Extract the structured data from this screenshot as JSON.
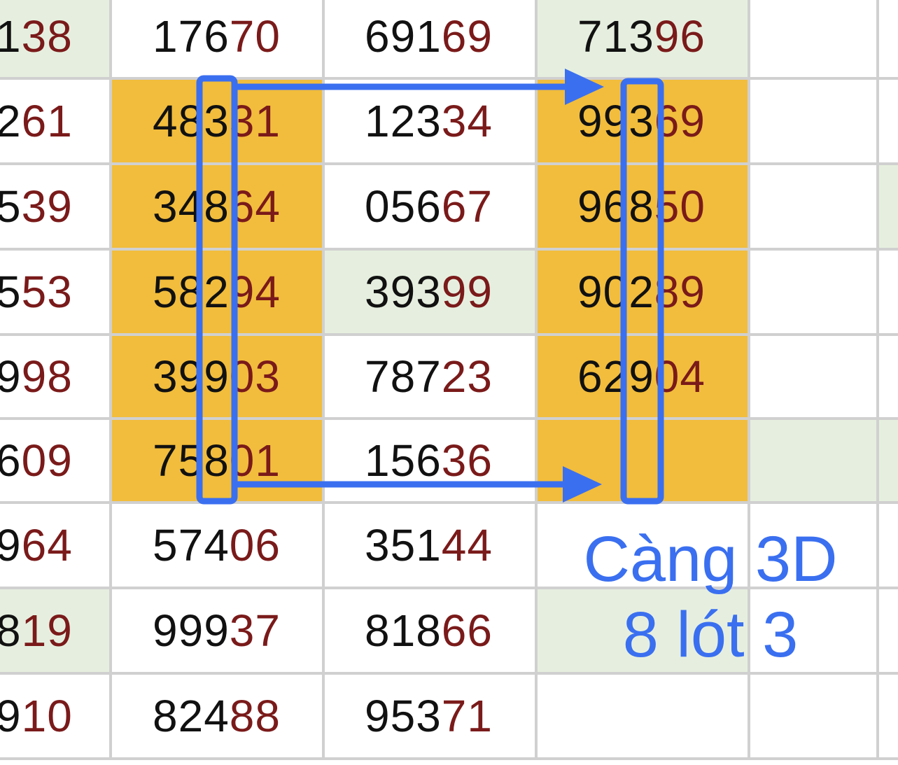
{
  "colors": {
    "highlight": "#f2bd3c",
    "shade": "#e6efdf",
    "plain": "#ffffff",
    "marker": "#3a6ff0",
    "digit_dark": "#111111",
    "digit_red": "#7a1a1a"
  },
  "rows": [
    {
      "cells": [
        {
          "black": "1",
          "red": "38",
          "bg": "shade"
        },
        {
          "black": "176",
          "red": "70",
          "bg": "plain"
        },
        {
          "black": "691",
          "red": "69",
          "bg": "plain"
        },
        {
          "black": "713",
          "red": "96",
          "bg": "shade"
        },
        {
          "bg": "plain"
        },
        {
          "bg": "plain"
        }
      ]
    },
    {
      "cells": [
        {
          "black": "2",
          "red": "61",
          "bg": "plain"
        },
        {
          "black": "483",
          "red": "31",
          "bg": "highlight"
        },
        {
          "black": "123",
          "red": "34",
          "bg": "plain"
        },
        {
          "black": "993",
          "red": "69",
          "bg": "highlight"
        },
        {
          "bg": "plain"
        },
        {
          "bg": "plain"
        }
      ]
    },
    {
      "cells": [
        {
          "black": "5",
          "red": "39",
          "bg": "plain"
        },
        {
          "black": "348",
          "red": "64",
          "bg": "highlight"
        },
        {
          "black": "056",
          "red": "67",
          "bg": "plain"
        },
        {
          "black": "968",
          "red": "50",
          "bg": "highlight"
        },
        {
          "bg": "plain"
        },
        {
          "bg": "shade"
        }
      ]
    },
    {
      "cells": [
        {
          "black": "5",
          "red": "53",
          "bg": "plain"
        },
        {
          "black": "582",
          "red": "94",
          "bg": "highlight"
        },
        {
          "black": "393",
          "red": "99",
          "bg": "shade"
        },
        {
          "black": "902",
          "red": "89",
          "bg": "highlight"
        },
        {
          "bg": "plain"
        },
        {
          "bg": "plain"
        }
      ]
    },
    {
      "cells": [
        {
          "black": "9",
          "red": "98",
          "bg": "plain"
        },
        {
          "black": "399",
          "red": "03",
          "bg": "highlight"
        },
        {
          "black": "787",
          "red": "23",
          "bg": "plain"
        },
        {
          "black": "629",
          "red": "04",
          "bg": "highlight"
        },
        {
          "bg": "plain"
        },
        {
          "bg": "plain"
        }
      ]
    },
    {
      "cells": [
        {
          "black": "6",
          "red": "09",
          "bg": "plain"
        },
        {
          "black": "758",
          "red": "01",
          "bg": "highlight"
        },
        {
          "black": "156",
          "red": "36",
          "bg": "plain"
        },
        {
          "bg": "highlight"
        },
        {
          "bg": "shade"
        },
        {
          "bg": "shade"
        }
      ]
    },
    {
      "cells": [
        {
          "black": "9",
          "red": "64",
          "bg": "plain"
        },
        {
          "black": "574",
          "red": "06",
          "bg": "plain"
        },
        {
          "black": "351",
          "red": "44",
          "bg": "plain"
        },
        {
          "bg": "plain"
        },
        {
          "bg": "plain"
        },
        {
          "bg": "plain"
        }
      ]
    },
    {
      "cells": [
        {
          "black": "8",
          "red": "19",
          "bg": "shade"
        },
        {
          "black": "999",
          "red": "37",
          "bg": "plain"
        },
        {
          "black": "818",
          "red": "66",
          "bg": "plain"
        },
        {
          "bg": "shade"
        },
        {
          "bg": "plain"
        },
        {
          "bg": "plain"
        }
      ]
    },
    {
      "cells": [
        {
          "black": "9",
          "red": "10",
          "bg": "plain"
        },
        {
          "black": "824",
          "red": "88",
          "bg": "plain"
        },
        {
          "black": "953",
          "red": "71",
          "bg": "plain"
        },
        {
          "bg": "plain"
        },
        {
          "bg": "plain"
        },
        {
          "bg": "plain"
        }
      ]
    }
  ],
  "caption": {
    "line1": "Càng 3D",
    "line2": "8 lót 3"
  }
}
